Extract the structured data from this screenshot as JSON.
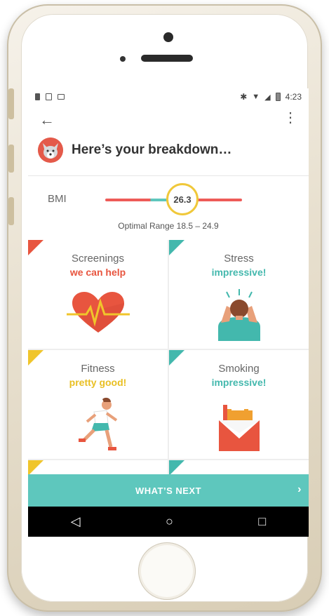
{
  "status_bar": {
    "time": "4:23"
  },
  "app_bar": {
    "back_glyph": "←",
    "more_glyph": "⋮"
  },
  "header": {
    "title": "Here’s your breakdown…"
  },
  "bmi": {
    "label": "BMI",
    "value": "26.3",
    "range_text": "Optimal Range 18.5 – 24.9"
  },
  "tiles": [
    {
      "name": "Screenings",
      "status": "we can help",
      "status_color": "#e8553f",
      "corner_color": "#e8553f",
      "icon": "heart-icon"
    },
    {
      "name": "Stress",
      "status": "impressive!",
      "status_color": "#43b8ad",
      "corner_color": "#43b8ad",
      "icon": "stressed-person-icon"
    },
    {
      "name": "Fitness",
      "status": "pretty good!",
      "status_color": "#e9bf22",
      "corner_color": "#f0c52b",
      "icon": "runner-icon"
    },
    {
      "name": "Smoking",
      "status": "impressive!",
      "status_color": "#43b8ad",
      "corner_color": "#43b8ad",
      "icon": "cigarette-pack-icon"
    }
  ],
  "next": {
    "label": "WHAT’S NEXT",
    "chevron": "›"
  },
  "nav": {
    "back": "◁",
    "home": "○",
    "recents": "□"
  }
}
